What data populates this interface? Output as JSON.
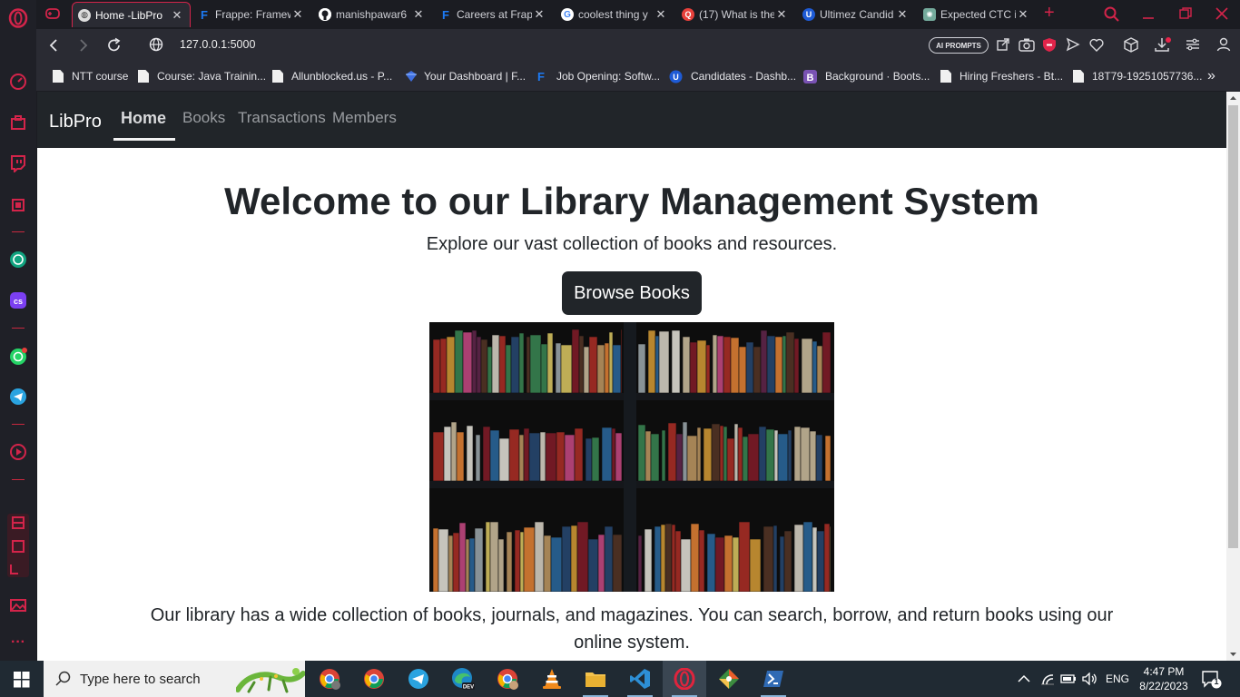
{
  "browser": {
    "tabs": [
      {
        "label": "Home -LibPro",
        "favicon": "globe-icon",
        "color": "#ffffff"
      },
      {
        "label": "Frappe: Framew",
        "favicon": "frappe-icon",
        "color": "#1d7af3"
      },
      {
        "label": "manishpawar6",
        "favicon": "github-icon",
        "color": "#ffffff"
      },
      {
        "label": "Careers at Frap",
        "favicon": "frappe-icon",
        "color": "#1d7af3"
      },
      {
        "label": "coolest thing y",
        "favicon": "google-icon",
        "color": "#4285f4"
      },
      {
        "label": "(17) What is the",
        "favicon": "quora-icon",
        "color": "#e8403b"
      },
      {
        "label": "Ultimez Candid",
        "favicon": "ultimez-icon",
        "color": "#1e5bd6"
      },
      {
        "label": "Expected CTC i",
        "favicon": "chatgpt-icon",
        "color": "#74aa9c"
      }
    ],
    "new_tab": "+",
    "close_glyph": "✕",
    "url": "127.0.0.1:5000",
    "ai_prompts": "AI PROMPTS",
    "bookmarks": [
      {
        "label": "NTT course"
      },
      {
        "label": "Course: Java Trainin..."
      },
      {
        "label": "Allunblocked.us - P..."
      },
      {
        "label": "Your Dashboard | F..."
      },
      {
        "label": "Job Opening: Softw..."
      },
      {
        "label": "Candidates - Dashb..."
      },
      {
        "label": "Background · Boots..."
      },
      {
        "label": "Hiring Freshers - Bt..."
      },
      {
        "label": "18T79-19251057736..."
      }
    ],
    "bookmarks_more": "»"
  },
  "app": {
    "brand": "LibPro",
    "nav": [
      {
        "label": "Home"
      },
      {
        "label": "Books"
      },
      {
        "label": "Transactions"
      },
      {
        "label": "Members"
      }
    ],
    "hero_title": "Welcome to our Library Management System",
    "hero_subtitle": "Explore our vast collection of books and resources.",
    "browse_button": "Browse Books",
    "description": "Our library has a wide collection of books, journals, and magazines. You can search, borrow, and return books using our online system."
  },
  "taskbar": {
    "search_placeholder": "Type here to search",
    "language": "ENG",
    "time": "4:47 PM",
    "date": "8/22/2023",
    "notification_count": "1"
  },
  "colors": {
    "accent": "#d3244a",
    "navbar": "#212529",
    "button": "#212529"
  }
}
